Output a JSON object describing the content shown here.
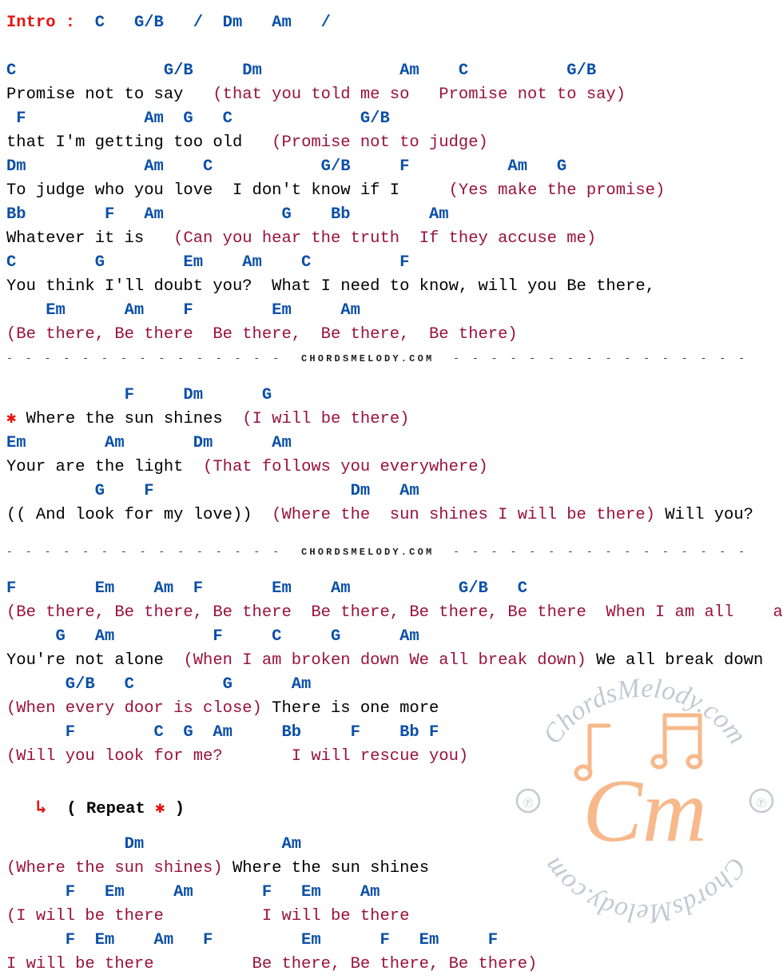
{
  "document": {
    "kind": "chord-sheet",
    "brand": "CHORDSMELODY.COM"
  },
  "intro": {
    "label": "Intro :",
    "chords": "C   G/B   /  Dm   Am   /",
    "chord_list": [
      "C",
      "G/B",
      "/",
      "Dm",
      "Am",
      "/"
    ]
  },
  "section1": {
    "lines": [
      {
        "type": "chords",
        "text": "C               G/B     Dm              Am    C          G/B"
      },
      {
        "type": "lyrics",
        "segments": [
          {
            "color": "black",
            "text": "Promise not to say   "
          },
          {
            "color": "echo",
            "text": "(that you told me so"
          },
          {
            "color": "black",
            "text": "   "
          },
          {
            "color": "echo",
            "text": "Promise not to say)"
          }
        ]
      },
      {
        "type": "chords",
        "text": " F            Am  G   C             G/B"
      },
      {
        "type": "lyrics",
        "segments": [
          {
            "color": "black",
            "text": "that I'm getting too old  "
          },
          {
            "color": "echo",
            "text": " (Promise not to judge)"
          }
        ]
      },
      {
        "type": "chords",
        "text": "Dm            Am    C           G/B     F          Am   G"
      },
      {
        "type": "lyrics",
        "segments": [
          {
            "color": "black",
            "text": "To judge who you love  I don't know if I   "
          },
          {
            "color": "echo",
            "text": "  (Yes make the promise)"
          }
        ]
      },
      {
        "type": "chords",
        "text": "Bb        F   Am            G    Bb        Am"
      },
      {
        "type": "lyrics",
        "segments": [
          {
            "color": "black",
            "text": "Whatever it is  "
          },
          {
            "color": "echo",
            "text": " (Can you hear the truth  If they accuse me)"
          }
        ]
      },
      {
        "type": "chords",
        "text": "C        G        Em    Am    C         F"
      },
      {
        "type": "lyrics",
        "segments": [
          {
            "color": "black",
            "text": "You think I'll doubt you?  What I need to know, will you Be there,"
          }
        ]
      },
      {
        "type": "chords",
        "text": "    Em      Am    F        Em     Am"
      },
      {
        "type": "lyrics",
        "segments": [
          {
            "color": "echo",
            "text": "(Be there, Be there  Be there,  Be there,  Be there)"
          }
        ]
      }
    ]
  },
  "divider1": {
    "brand": "CHORDSMELODY.COM"
  },
  "section2": {
    "lines": [
      {
        "type": "chords",
        "text": "            F     Dm      G"
      },
      {
        "type": "lyrics",
        "segments": [
          {
            "color": "red",
            "text": "✱"
          },
          {
            "color": "black",
            "text": " Where the sun shines  "
          },
          {
            "color": "echo",
            "text": "(I will be there)"
          }
        ]
      },
      {
        "type": "chords",
        "text": "Em        Am       Dm      Am"
      },
      {
        "type": "lyrics",
        "segments": [
          {
            "color": "black",
            "text": "Your are the light  "
          },
          {
            "color": "echo",
            "text": "(That follows you everywhere)"
          }
        ]
      },
      {
        "type": "chords",
        "text": "         G    F                    Dm   Am"
      },
      {
        "type": "lyrics",
        "segments": [
          {
            "color": "black",
            "text": "(( And look for my love))  "
          },
          {
            "color": "echo",
            "text": "(Where the  sun shines I will be there)"
          },
          {
            "color": "black",
            "text": " Will you?"
          }
        ]
      }
    ]
  },
  "divider2": {
    "brand": "CHORDSMELODY.COM"
  },
  "section3": {
    "lines": [
      {
        "type": "chords",
        "text": "F        Em    Am  F       Em    Am           G/B   C"
      },
      {
        "type": "lyrics",
        "segments": [
          {
            "color": "echo",
            "text": "(Be there, Be there, Be there  Be there, Be there, Be there  When I am all    alone)"
          }
        ]
      },
      {
        "type": "chords",
        "text": "     G   Am          F     C     G      Am"
      },
      {
        "type": "lyrics",
        "segments": [
          {
            "color": "black",
            "text": "You're not alone  "
          },
          {
            "color": "echo",
            "text": "(When I am broken down We all break down)"
          },
          {
            "color": "black",
            "text": " We all break down"
          }
        ]
      },
      {
        "type": "chords",
        "text": "      G/B   C         G      Am"
      },
      {
        "type": "lyrics",
        "segments": [
          {
            "color": "echo",
            "text": "(When every door is close)"
          },
          {
            "color": "black",
            "text": " There is one more"
          }
        ]
      },
      {
        "type": "chords",
        "text": "      F        C  G  Am     Bb     F    Bb F"
      },
      {
        "type": "lyrics",
        "segments": [
          {
            "color": "echo",
            "text": "(Will you look for me?       I will rescue you)"
          }
        ]
      }
    ]
  },
  "repeat": {
    "arrow": "↳",
    "open": "( Repeat ",
    "star": "✱",
    "close": " )"
  },
  "section4": {
    "lines": [
      {
        "type": "chords",
        "text": "            Dm              Am"
      },
      {
        "type": "lyrics",
        "segments": [
          {
            "color": "echo",
            "text": "(Where the sun shines)"
          },
          {
            "color": "black",
            "text": " Where the sun shines"
          }
        ]
      },
      {
        "type": "chords",
        "text": "      F   Em     Am       F   Em    Am"
      },
      {
        "type": "lyrics",
        "segments": [
          {
            "color": "echo",
            "text": "(I will be there          I will be there"
          }
        ]
      },
      {
        "type": "chords",
        "text": "      F  Em    Am   F         Em      F   Em     F"
      },
      {
        "type": "lyrics",
        "segments": [
          {
            "color": "echo",
            "text": "I will be there          Be there, Be there, Be there)"
          }
        ]
      }
    ]
  },
  "watermark": {
    "center_text": "Cm",
    "ring_text_top": "ChordsMelody.com",
    "ring_text_bottom": "ChordsMelody.com",
    "left_mark": "℗",
    "right_mark": "℗",
    "colors": {
      "peach": "#F7B98B",
      "grey": "#C3CAD1"
    }
  },
  "colors": {
    "chord_blue": "#0B4FA8",
    "lyric_black": "#000000",
    "echo_crimson": "#99123C",
    "accent_red": "#E8110E",
    "background": "#ffffff"
  }
}
